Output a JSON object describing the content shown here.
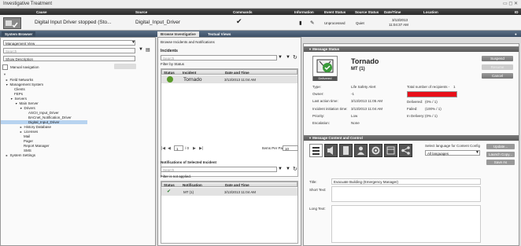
{
  "window": {
    "title": "Investigative Treatment",
    "controls": "▭ ◻ ✕"
  },
  "event_header": {
    "columns": [
      "Cause",
      "Source",
      "Commands",
      "Information",
      "Event Status",
      "Source Status",
      "Date/Time",
      "Location",
      "ID"
    ]
  },
  "event_row": {
    "cause": "Digital Input Driver stopped (Sto...",
    "source": "Digital_Input_Driver",
    "command_icon": "checkmark-icon",
    "event_status": "Unprocessed",
    "source_status": "Quiet",
    "date": "3/13/2013",
    "time": "11:04:37 AM"
  },
  "tabs": {
    "system_browser": "System Browser",
    "browse_investigative": "Browse Investigative",
    "textual_views": "Textual Views"
  },
  "left": {
    "view_select": "Management View",
    "search_placeholder": "Search",
    "description_select": "Show Description",
    "manual_navigation": "Manual navigation",
    "tree": [
      {
        "label": "Field Networks",
        "indent": 1,
        "toggle": "►"
      },
      {
        "label": "Management System",
        "indent": 1,
        "toggle": "▼"
      },
      {
        "label": "Clients",
        "indent": 2,
        "toggle": ""
      },
      {
        "label": "FEPs",
        "indent": 2,
        "toggle": ""
      },
      {
        "label": "Servers",
        "indent": 2,
        "toggle": "▼"
      },
      {
        "label": "Main Server",
        "indent": 3,
        "toggle": "▼"
      },
      {
        "label": "Drivers",
        "indent": 4,
        "toggle": "▼"
      },
      {
        "label": "ASCII_Input_Driver",
        "indent": 5,
        "toggle": ""
      },
      {
        "label": "BACnet_Notification_Driver",
        "indent": 5,
        "toggle": ""
      },
      {
        "label": "Digital_Input_Driver",
        "indent": 5,
        "toggle": "",
        "selected": true
      },
      {
        "label": "History Database",
        "indent": 4,
        "toggle": "►"
      },
      {
        "label": "Licenses",
        "indent": 4,
        "toggle": "►"
      },
      {
        "label": "Mail",
        "indent": 4,
        "toggle": ""
      },
      {
        "label": "Pager",
        "indent": 4,
        "toggle": ""
      },
      {
        "label": "Report Manager",
        "indent": 4,
        "toggle": ""
      },
      {
        "label": "SMS",
        "indent": 4,
        "toggle": ""
      },
      {
        "label": "System Settings",
        "indent": 1,
        "toggle": "►"
      }
    ]
  },
  "middle": {
    "breadcrumb": "Browse Incidents and Notifications",
    "incidents_title": "Incidents",
    "search_placeholder": "Search",
    "filter_text": "Filter by Status",
    "columns": [
      "Status",
      "Incident",
      "Date and Time"
    ],
    "rows": [
      {
        "incident": "Tornado",
        "datetime": "3/13/2013 11:04 AM"
      }
    ],
    "pager_page": "1",
    "pager_of": "/ 0",
    "items_per_page_label": "Items Per Page:",
    "items_per_page": "10",
    "notifications_title": "Notifications of Selected Incident",
    "notif_search_placeholder": "Search",
    "notif_filter_text": "Filter is not applied.",
    "notif_columns": [
      "Status",
      "Notification",
      "Date and Time"
    ],
    "notif_rows": [
      {
        "notification": "MT (1)",
        "datetime": "3/13/2013 11:04 AM"
      }
    ]
  },
  "right": {
    "message_status_title": "Message Status",
    "message_name": "Tornado",
    "message_sub": "MT (1)",
    "status_label": "Delivered",
    "fields": [
      {
        "label": "Type:",
        "value": "Life Safety Alert"
      },
      {
        "label": "Owner:",
        "value": "-1"
      },
      {
        "label": "Last action time:",
        "value": "3/13/2013 11:05 AM"
      },
      {
        "label": "Incident initiation time:",
        "value": "3/13/2013 11:04 AM"
      },
      {
        "label": "Priority:",
        "value": "Low"
      },
      {
        "label": "Escalation:",
        "value": "None"
      }
    ],
    "recipients_label": "Total number of recipients -",
    "recipients_count": "1",
    "stats": [
      {
        "label": "Delivered:",
        "value": "(0% / 1)"
      },
      {
        "label": "Failed:",
        "value": "(100% / 1)"
      },
      {
        "label": "In Delivery:",
        "value": "(0% / 1)"
      }
    ],
    "buttons": [
      "Suspend",
      "Resume",
      "Cancel"
    ],
    "content_title": "Message Content and Control",
    "language_label": "Select language for Content Config",
    "language_value": "All languages",
    "side_buttons": [
      "Update...",
      "Launch Copy...",
      "Save As"
    ],
    "title_label": "Title:",
    "title_value": "Evacuate Building (Emergency Manager)",
    "short_text_label": "Short Text:",
    "long_text_label": "Long Text:",
    "colors": {
      "failed_bar": "#e8101a",
      "header_blue": "#4a5f78"
    }
  }
}
